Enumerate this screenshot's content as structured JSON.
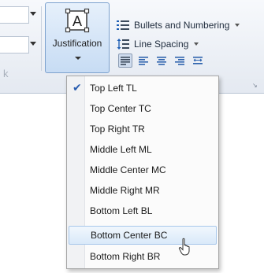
{
  "ribbon": {
    "justification_label": "Justification",
    "bullets_label": "Bullets and Numbering",
    "line_spacing_label": "Line Spacing",
    "partial_text": "k",
    "align_buttons": [
      "justify-left-selected",
      "align-left",
      "align-center",
      "align-right",
      "distribute"
    ]
  },
  "justification_menu": {
    "selected": "Top Left TL",
    "hovered": "Bottom Center BC",
    "items": [
      "Top Left TL",
      "Top Center TC",
      "Top Right TR",
      "Middle Left ML",
      "Middle Center MC",
      "Middle Right MR",
      "Bottom Left BL",
      "Bottom Center BC",
      "Bottom Right BR"
    ]
  },
  "colors": {
    "accent_blue": "#2a5db0",
    "hover_border": "#a8c7ea",
    "hover_fill": "#d9e9f9"
  }
}
